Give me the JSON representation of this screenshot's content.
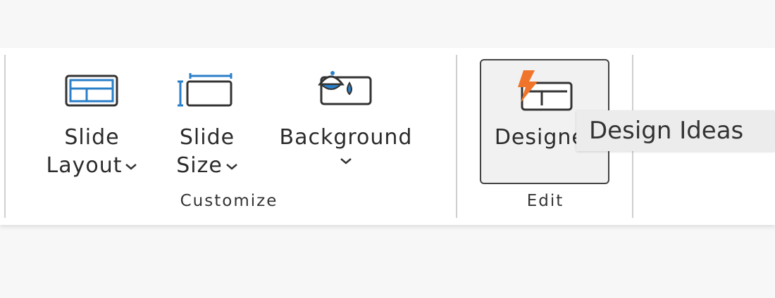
{
  "ribbon": {
    "customize": {
      "slide_layout": {
        "line1": "Slide",
        "line2": "Layout"
      },
      "slide_size": {
        "line1": "Slide",
        "line2": "Size"
      },
      "background": {
        "label": "Background"
      },
      "group_label": "Customize"
    },
    "edit": {
      "designer": {
        "label": "Designer"
      },
      "group_label": "Edit"
    }
  },
  "tooltip": {
    "text": "Design Ideas"
  },
  "colors": {
    "accent_blue": "#2a7fc9",
    "designer_orange": "#f0742a"
  },
  "icons": {
    "slide_layout": "slide-layout-icon",
    "slide_size": "slide-size-icon",
    "background": "format-background-icon",
    "designer": "designer-icon",
    "chevron": "chevron-down-icon"
  }
}
